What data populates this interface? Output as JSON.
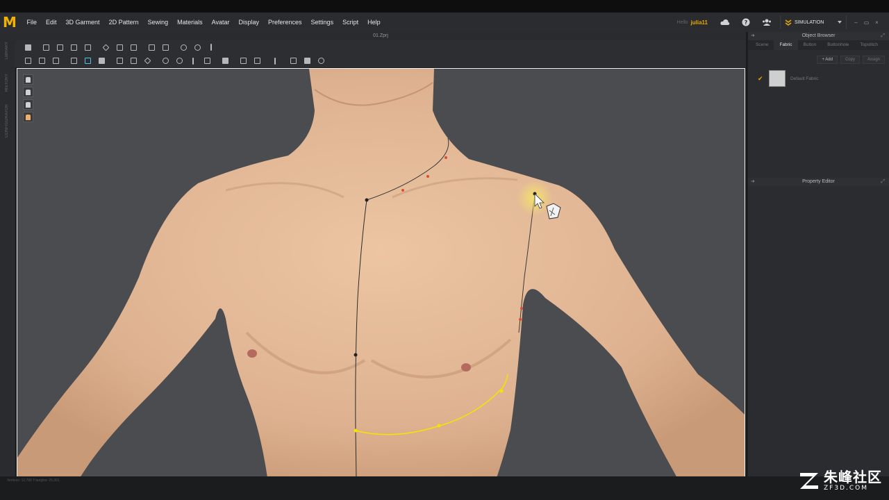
{
  "app": {
    "logo_letter": "M",
    "document_title": "01.Zprj"
  },
  "menu": [
    "File",
    "Edit",
    "3D Garment",
    "2D Pattern",
    "Sewing",
    "Materials",
    "Avatar",
    "Display",
    "Preferences",
    "Settings",
    "Script",
    "Help"
  ],
  "user": {
    "prefix": "Hello",
    "name": "julia11"
  },
  "mode": {
    "label": "SIMULATION"
  },
  "window_controls": [
    "–",
    "▭",
    "×"
  ],
  "side_tabs": [
    "LIBRARY",
    "HISTORY",
    "CONFIGURATOR"
  ],
  "object_browser": {
    "title": "Object Browser",
    "tabs": [
      "Scene",
      "Fabric",
      "Button",
      "Buttonhole",
      "Topstitch"
    ],
    "active_tab": "Fabric",
    "buttons": [
      "+ Add",
      "Copy",
      "Assign"
    ],
    "fabric_item": {
      "name": "Default Fabric"
    }
  },
  "property_editor": {
    "title": "Property Editor"
  },
  "status": {
    "text": "Vertices: 12,788   Triangles: 25,301"
  },
  "watermark": {
    "chinese": "朱峰社区",
    "url": "ZF3D.COM"
  },
  "colors": {
    "accent": "#e8a900",
    "viewport_bg": "#4b4c50",
    "seam_yellow": "#f5e400",
    "skin": "#e3b794"
  }
}
